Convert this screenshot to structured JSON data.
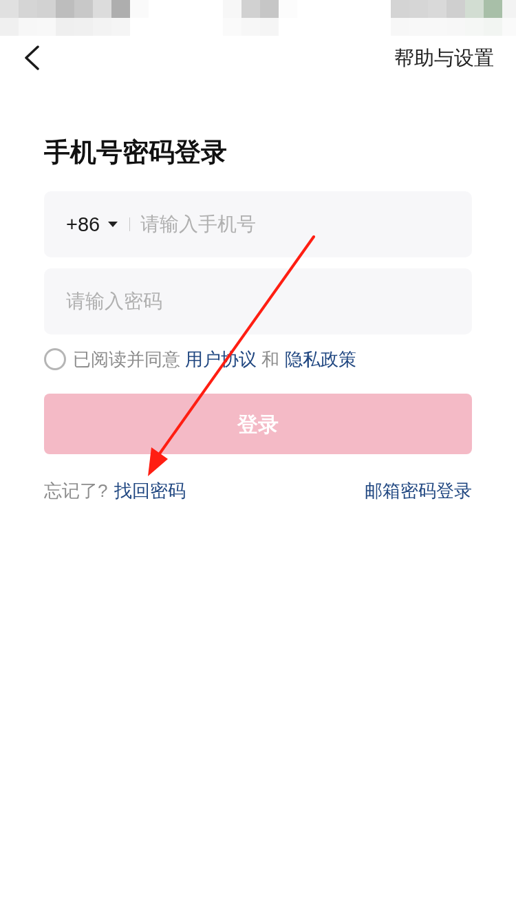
{
  "nav": {
    "help_link": "帮助与设置"
  },
  "heading": "手机号密码登录",
  "phone_field": {
    "country_code": "+86",
    "placeholder": "请输入手机号"
  },
  "password_field": {
    "placeholder": "请输入密码"
  },
  "agreement": {
    "checked": false,
    "parts": [
      {
        "kind": "text",
        "text": "已阅读并同意"
      },
      {
        "kind": "link",
        "text": "用户协议"
      },
      {
        "kind": "text",
        "text": "和"
      },
      {
        "kind": "link",
        "text": "隐私政策"
      }
    ]
  },
  "login_button": {
    "label": "登录",
    "disabled": true
  },
  "forgot": {
    "prompt": "忘记了?",
    "link": "找回密码"
  },
  "email_login_link": "邮箱密码登录"
}
